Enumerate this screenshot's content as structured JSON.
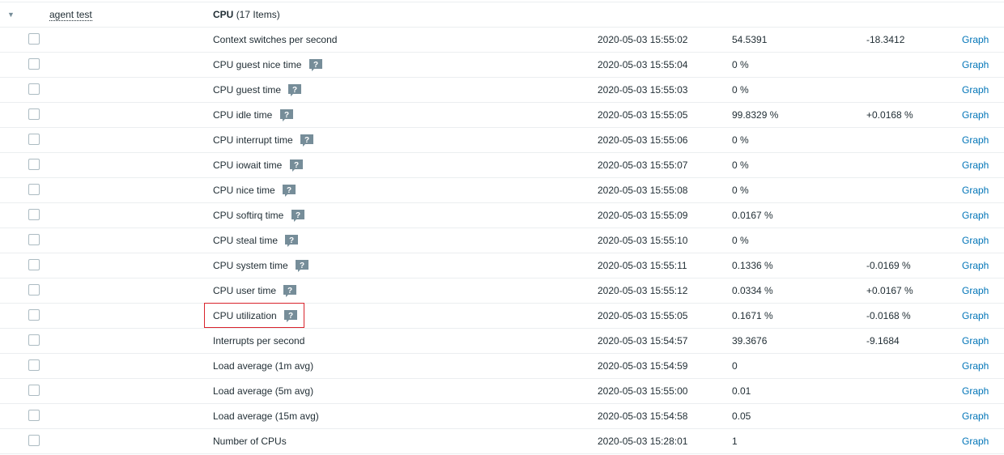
{
  "group": {
    "host": "agent test",
    "title": "CPU",
    "count": "(17 Items)"
  },
  "graph_label": "Graph",
  "hint_glyph": "?",
  "rows": [
    {
      "name": "Context switches per second",
      "hint": false,
      "time": "2020-05-03 15:55:02",
      "value": "54.5391",
      "change": "-18.3412"
    },
    {
      "name": "CPU guest nice time",
      "hint": true,
      "time": "2020-05-03 15:55:04",
      "value": "0 %",
      "change": ""
    },
    {
      "name": "CPU guest time",
      "hint": true,
      "time": "2020-05-03 15:55:03",
      "value": "0 %",
      "change": ""
    },
    {
      "name": "CPU idle time",
      "hint": true,
      "time": "2020-05-03 15:55:05",
      "value": "99.8329 %",
      "change": "+0.0168 %"
    },
    {
      "name": "CPU interrupt time",
      "hint": true,
      "time": "2020-05-03 15:55:06",
      "value": "0 %",
      "change": ""
    },
    {
      "name": "CPU iowait time",
      "hint": true,
      "time": "2020-05-03 15:55:07",
      "value": "0 %",
      "change": ""
    },
    {
      "name": "CPU nice time",
      "hint": true,
      "time": "2020-05-03 15:55:08",
      "value": "0 %",
      "change": ""
    },
    {
      "name": "CPU softirq time",
      "hint": true,
      "time": "2020-05-03 15:55:09",
      "value": "0.0167 %",
      "change": ""
    },
    {
      "name": "CPU steal time",
      "hint": true,
      "time": "2020-05-03 15:55:10",
      "value": "0 %",
      "change": ""
    },
    {
      "name": "CPU system time",
      "hint": true,
      "time": "2020-05-03 15:55:11",
      "value": "0.1336 %",
      "change": "-0.0169 %"
    },
    {
      "name": "CPU user time",
      "hint": true,
      "time": "2020-05-03 15:55:12",
      "value": "0.0334 %",
      "change": "+0.0167 %"
    },
    {
      "name": "CPU utilization",
      "hint": true,
      "time": "2020-05-03 15:55:05",
      "value": "0.1671 %",
      "change": "-0.0168 %",
      "highlighted": true
    },
    {
      "name": "Interrupts per second",
      "hint": false,
      "time": "2020-05-03 15:54:57",
      "value": "39.3676",
      "change": "-9.1684"
    },
    {
      "name": "Load average (1m avg)",
      "hint": false,
      "time": "2020-05-03 15:54:59",
      "value": "0",
      "change": ""
    },
    {
      "name": "Load average (5m avg)",
      "hint": false,
      "time": "2020-05-03 15:55:00",
      "value": "0.01",
      "change": ""
    },
    {
      "name": "Load average (15m avg)",
      "hint": false,
      "time": "2020-05-03 15:54:58",
      "value": "0.05",
      "change": ""
    },
    {
      "name": "Number of CPUs",
      "hint": false,
      "time": "2020-05-03 15:28:01",
      "value": "1",
      "change": ""
    }
  ],
  "colors": {
    "link": "#0275b8",
    "hint_bg": "#768d99",
    "highlight_border": "#d9232c",
    "row_border": "#ebeef0"
  }
}
